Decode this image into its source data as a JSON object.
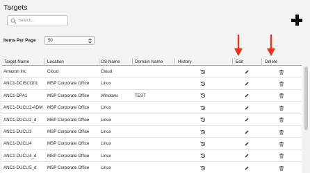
{
  "page": {
    "title": "Targets"
  },
  "search": {
    "placeholder": "Search..."
  },
  "toolbar": {
    "add_icon": "plus-icon"
  },
  "items_per_page": {
    "label": "Items Per Page",
    "selected": "50"
  },
  "table": {
    "columns": [
      "Target Name",
      "Location",
      "OS Name",
      "Domain Name",
      "History",
      "Edit",
      "Delete"
    ],
    "rows": [
      {
        "target_name": "Amazon Inc",
        "location": "Cloud",
        "os_name": "Cloud",
        "domain_name": ""
      },
      {
        "target_name": "ANC1-DCISCO01",
        "location": "MSP Corporate Office",
        "os_name": "Linux",
        "domain_name": ""
      },
      {
        "target_name": "ANC1-DPA1",
        "location": "MSP Corporate Office",
        "os_name": "Windows",
        "domain_name": "TEST"
      },
      {
        "target_name": "ANC1-DUCLI2-ADM",
        "location": "MSP Corporate Office",
        "os_name": "Linux",
        "domain_name": ""
      },
      {
        "target_name": "ANC1-DUCLI2_d",
        "location": "MSP Corporate Office",
        "os_name": "Linux",
        "domain_name": ""
      },
      {
        "target_name": "ANC1-DUCLI3",
        "location": "MSP Corporate Office",
        "os_name": "Linux",
        "domain_name": ""
      },
      {
        "target_name": "ANC1-DUCLI4",
        "location": "MSP Corporate Office",
        "os_name": "Linux",
        "domain_name": ""
      },
      {
        "target_name": "ANC1-DUCLI4_d",
        "location": "MSP Corporate Office",
        "os_name": "Linux",
        "domain_name": ""
      },
      {
        "target_name": "ANC1-DUCLI5_d",
        "location": "MSP Corporate Office",
        "os_name": "Linux",
        "domain_name": ""
      }
    ],
    "row_icons": {
      "history": "history-icon",
      "edit": "pencil-icon",
      "delete": "trash-icon"
    }
  },
  "annotations": {
    "arrow_color": "#e8331c"
  }
}
